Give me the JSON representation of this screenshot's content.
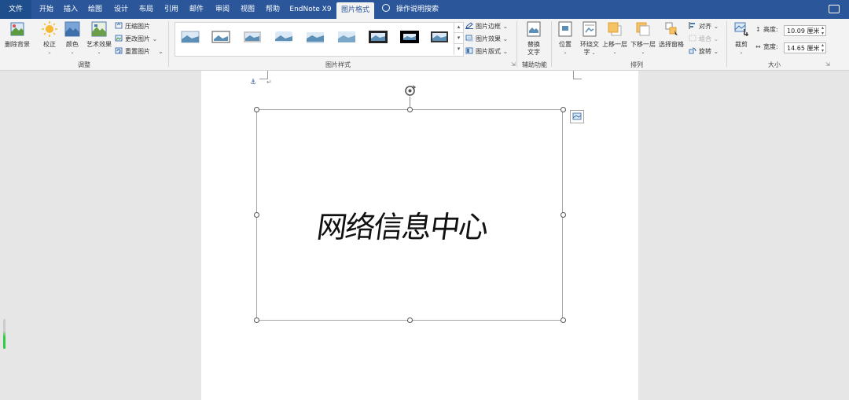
{
  "tabs": [
    {
      "label": "文件",
      "active": false
    },
    {
      "label": "开始",
      "active": false
    },
    {
      "label": "插入",
      "active": false
    },
    {
      "label": "绘图",
      "active": false
    },
    {
      "label": "设计",
      "active": false
    },
    {
      "label": "布局",
      "active": false
    },
    {
      "label": "引用",
      "active": false
    },
    {
      "label": "邮件",
      "active": false
    },
    {
      "label": "审阅",
      "active": false
    },
    {
      "label": "视图",
      "active": false
    },
    {
      "label": "帮助",
      "active": false
    },
    {
      "label": "EndNote X9",
      "active": false
    },
    {
      "label": "图片格式",
      "active": true
    }
  ],
  "search": {
    "placeholder": "操作说明搜索"
  },
  "ribbon": {
    "adjust": {
      "label": "调整",
      "remove_bg": "删除背景",
      "corrections": "校正",
      "color": "颜色",
      "artistic": "艺术效果",
      "compress": "压缩图片",
      "change": "更改图片",
      "reset": "重置图片"
    },
    "styles": {
      "label": "图片样式",
      "border": "图片边框",
      "effects": "图片效果",
      "layout": "图片版式"
    },
    "accessibility": {
      "label": "辅助功能",
      "alt_text_line1": "替换",
      "alt_text_line2": "文字"
    },
    "arrange": {
      "label": "排列",
      "position": "位置",
      "wrap_line1": "环绕文",
      "wrap_line2": "字",
      "forward": "上移一层",
      "backward": "下移一层",
      "selection_pane": "选择窗格",
      "align": "对齐",
      "group": "组合",
      "rotate": "旋转"
    },
    "size": {
      "label": "大小",
      "crop": "裁剪",
      "height_label": "高度:",
      "height_value": "10.09 厘米",
      "width_label": "宽度:",
      "width_value": "14.65 厘米"
    }
  },
  "document": {
    "signature_text": "网络信息中心",
    "paragraph_mark": "↵",
    "anchor_glyph": "⚓"
  },
  "colors": {
    "tabbar": "#2b579a",
    "ribbon": "#f3f3f3",
    "canvas": "#e6e6e6",
    "accent_green": "#2ecc40"
  }
}
